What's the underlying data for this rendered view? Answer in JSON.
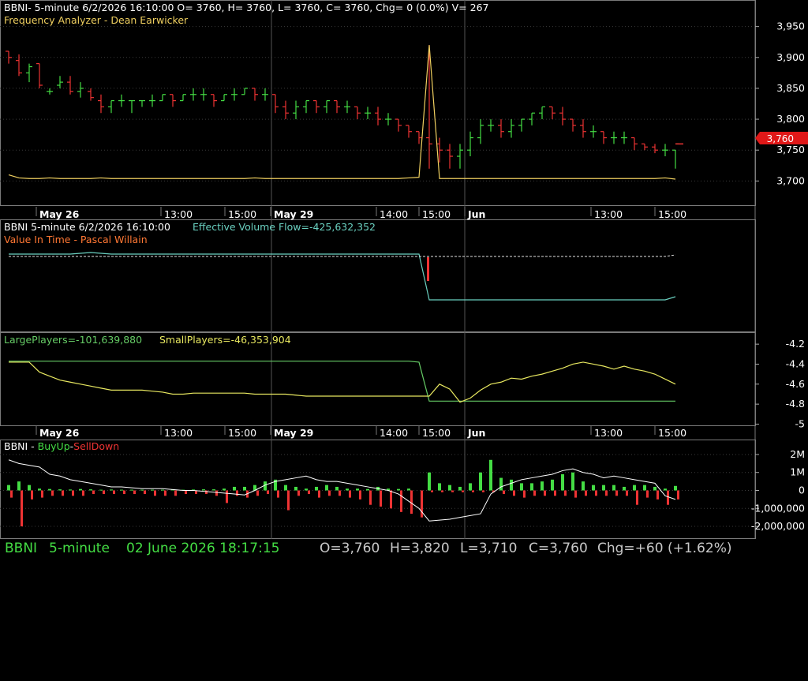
{
  "theme": {
    "bg": "#000000",
    "text": "#ffffff",
    "grid": "#3a3a3a",
    "panel_line": "#7a7a7a",
    "up": "#44dd44",
    "down": "#ee3333",
    "yellow": "#f0d060",
    "cyan": "#6ad0c0",
    "orange": "#ff7733",
    "green_line": "#66cc66",
    "yellow_line": "#e8e860",
    "price_marker": "#e01818"
  },
  "panel1": {
    "header": "BBNI- 5-minute 6/2/2026 16:10:00 O= 3760, H= 3760, L= 3760, C= 3760, Chg= 0 (0.0%) V= 267",
    "indicator": "Frequency Analyzer - Dean Earwicker",
    "price_marker": "3,760"
  },
  "panel2": {
    "header": "BBNI 5-minute  6/2/2026 16:10:00",
    "evf_label": "Effective Volume Flow=-425,632,352",
    "indicator": "Value In Time - Pascal Willain"
  },
  "panel3": {
    "large_label": "LargePlayers=-101,639,880",
    "small_label": "SmallPlayers=-46,353,904"
  },
  "panel4": {
    "title_prefix": "BBNI - ",
    "buyup": "BuyUp",
    "dash": "-",
    "selldown": "SellDown"
  },
  "time_axis": {
    "labels": [
      "May 26",
      "13:00",
      "15:00",
      "May 29",
      "14:00",
      "15:00",
      "Jun",
      "13:00",
      "15:00"
    ],
    "bold": [
      true,
      false,
      false,
      true,
      false,
      false,
      true,
      false,
      false
    ]
  },
  "status_bar": {
    "symbol": "BBNI",
    "interval": "5-minute",
    "datetime": "02 June 2026 18:17:15",
    "open": "O=3,760",
    "high": "H=3,820",
    "low": "L=3,710",
    "close": "C=3,760",
    "chg": "Chg=+60 (+1.62%)"
  },
  "chart_data": [
    {
      "type": "bar",
      "name": "price",
      "y_ticks": [
        "3,950",
        "3,900",
        "3,850",
        "3,800",
        "3,750",
        "3,700"
      ],
      "ylim": [
        3680,
        3970
      ],
      "last_price": 3760,
      "bars": [
        [
          3910,
          3910,
          3890,
          3900
        ],
        [
          3895,
          3905,
          3870,
          3875
        ],
        [
          3875,
          3890,
          3860,
          3885
        ],
        [
          3890,
          3890,
          3850,
          3855
        ],
        [
          3845,
          3850,
          3840,
          3845
        ],
        [
          3855,
          3870,
          3850,
          3860
        ],
        [
          3860,
          3870,
          3840,
          3845
        ],
        [
          3845,
          3860,
          3835,
          3850
        ],
        [
          3845,
          3850,
          3830,
          3835
        ],
        [
          3830,
          3840,
          3810,
          3820
        ],
        [
          3820,
          3830,
          3810,
          3830
        ],
        [
          3830,
          3840,
          3820,
          3830
        ],
        [
          3830,
          3830,
          3810,
          3830
        ],
        [
          3830,
          3830,
          3820,
          3830
        ],
        [
          3830,
          3840,
          3820,
          3830
        ],
        [
          3830,
          3840,
          3830,
          3840
        ],
        [
          3840,
          3840,
          3820,
          3830
        ],
        [
          3830,
          3840,
          3830,
          3840
        ],
        [
          3840,
          3850,
          3830,
          3840
        ],
        [
          3840,
          3850,
          3830,
          3840
        ],
        [
          3840,
          3840,
          3820,
          3830
        ],
        [
          3830,
          3840,
          3830,
          3840
        ],
        [
          3840,
          3850,
          3830,
          3840
        ],
        [
          3840,
          3850,
          3840,
          3850
        ],
        [
          3850,
          3850,
          3830,
          3840
        ],
        [
          3840,
          3850,
          3830,
          3840
        ],
        [
          3840,
          3840,
          3810,
          3820
        ],
        [
          3820,
          3830,
          3800,
          3810
        ],
        [
          3810,
          3830,
          3800,
          3820
        ],
        [
          3820,
          3830,
          3810,
          3830
        ],
        [
          3830,
          3830,
          3810,
          3820
        ],
        [
          3820,
          3830,
          3810,
          3830
        ],
        [
          3830,
          3830,
          3810,
          3820
        ],
        [
          3820,
          3830,
          3810,
          3820
        ],
        [
          3820,
          3820,
          3800,
          3810
        ],
        [
          3810,
          3820,
          3800,
          3810
        ],
        [
          3810,
          3820,
          3790,
          3800
        ],
        [
          3800,
          3810,
          3790,
          3800
        ],
        [
          3800,
          3800,
          3780,
          3790
        ],
        [
          3790,
          3790,
          3770,
          3780
        ],
        [
          3780,
          3780,
          3760,
          3770
        ],
        [
          3770,
          3920,
          3720,
          3760
        ],
        [
          3760,
          3770,
          3730,
          3750
        ],
        [
          3750,
          3760,
          3720,
          3740
        ],
        [
          3740,
          3760,
          3720,
          3750
        ],
        [
          3750,
          3780,
          3740,
          3770
        ],
        [
          3770,
          3800,
          3760,
          3790
        ],
        [
          3790,
          3800,
          3780,
          3790
        ],
        [
          3790,
          3800,
          3770,
          3780
        ],
        [
          3780,
          3800,
          3770,
          3790
        ],
        [
          3790,
          3800,
          3780,
          3800
        ],
        [
          3800,
          3810,
          3790,
          3810
        ],
        [
          3810,
          3820,
          3800,
          3820
        ],
        [
          3820,
          3820,
          3800,
          3810
        ],
        [
          3810,
          3820,
          3790,
          3800
        ],
        [
          3800,
          3800,
          3780,
          3790
        ],
        [
          3790,
          3800,
          3770,
          3780
        ],
        [
          3780,
          3790,
          3770,
          3780
        ],
        [
          3780,
          3780,
          3760,
          3770
        ],
        [
          3770,
          3780,
          3760,
          3770
        ],
        [
          3770,
          3780,
          3760,
          3770
        ],
        [
          3770,
          3770,
          3750,
          3760
        ],
        [
          3760,
          3760,
          3750,
          3755
        ],
        [
          3755,
          3760,
          3745,
          3750
        ],
        [
          3750,
          3760,
          3740,
          3750
        ],
        [
          3750,
          3750,
          3720,
          3760
        ]
      ],
      "freq_line": [
        3710,
        3705,
        3704,
        3704,
        3705,
        3704,
        3704,
        3704,
        3704,
        3705,
        3704,
        3704,
        3704,
        3704,
        3704,
        3704,
        3704,
        3704,
        3704,
        3704,
        3704,
        3704,
        3704,
        3704,
        3705,
        3704,
        3704,
        3704,
        3704,
        3704,
        3704,
        3704,
        3704,
        3704,
        3704,
        3704,
        3704,
        3704,
        3704,
        3705,
        3706,
        3920,
        3704,
        3704,
        3704,
        3704,
        3704,
        3704,
        3704,
        3704,
        3704,
        3704,
        3704,
        3704,
        3704,
        3704,
        3704,
        3704,
        3704,
        3704,
        3704,
        3704,
        3704,
        3704,
        3705,
        3703
      ]
    },
    {
      "type": "line",
      "name": "effective volume flow",
      "series": [
        {
          "values_top": [
            322,
            322,
            322,
            322,
            322,
            322,
            322,
            321,
            320,
            321,
            322,
            322,
            322,
            322,
            322,
            322,
            322,
            322,
            322,
            322,
            322,
            322,
            322,
            322,
            322,
            322,
            322,
            322,
            322,
            322,
            322,
            322,
            322,
            322,
            322,
            322,
            322,
            322,
            322,
            322,
            322,
            380,
            380,
            380,
            380,
            380,
            380,
            380,
            380,
            380,
            380,
            380,
            380,
            380,
            380,
            380,
            380,
            380,
            380,
            380,
            380,
            380,
            380,
            380,
            380,
            376
          ]
        },
        {
          "values_white": [
            325,
            325,
            325,
            325,
            325,
            325,
            325,
            325,
            325,
            325,
            325,
            325,
            325,
            325,
            325,
            325,
            325,
            325,
            325,
            325,
            325,
            325,
            325,
            325,
            325,
            325,
            325,
            325,
            325,
            325,
            325,
            325,
            325,
            325,
            325,
            325,
            325,
            325,
            325,
            325,
            325,
            325,
            325,
            325,
            325,
            325,
            325,
            325,
            325,
            325,
            325,
            325,
            325,
            325,
            325,
            325,
            325,
            325,
            325,
            325,
            325,
            325,
            325,
            325,
            325,
            323
          ]
        }
      ]
    },
    {
      "type": "line",
      "name": "players",
      "y_ticks": [
        "-4.2",
        "-4.4",
        "-4.6",
        "-4.8",
        "-5"
      ],
      "ylim": [
        -5.02,
        -4.12
      ],
      "series": [
        {
          "name": "LargePlayers",
          "values": [
            -4.37,
            -4.37,
            -4.37,
            -4.37,
            -4.37,
            -4.37,
            -4.37,
            -4.37,
            -4.37,
            -4.37,
            -4.37,
            -4.37,
            -4.37,
            -4.37,
            -4.37,
            -4.37,
            -4.37,
            -4.37,
            -4.37,
            -4.37,
            -4.37,
            -4.37,
            -4.37,
            -4.37,
            -4.37,
            -4.37,
            -4.37,
            -4.37,
            -4.37,
            -4.37,
            -4.37,
            -4.37,
            -4.37,
            -4.37,
            -4.37,
            -4.37,
            -4.37,
            -4.37,
            -4.37,
            -4.37,
            -4.38,
            -4.77,
            -4.77,
            -4.77,
            -4.77,
            -4.77,
            -4.77,
            -4.77,
            -4.77,
            -4.77,
            -4.77,
            -4.77,
            -4.77,
            -4.77,
            -4.77,
            -4.77,
            -4.77,
            -4.77,
            -4.77,
            -4.77,
            -4.77,
            -4.77,
            -4.77,
            -4.77,
            -4.77,
            -4.77
          ]
        },
        {
          "name": "SmallPlayers",
          "values": [
            -4.38,
            -4.38,
            -4.38,
            -4.48,
            -4.52,
            -4.56,
            -4.58,
            -4.6,
            -4.62,
            -4.64,
            -4.66,
            -4.66,
            -4.66,
            -4.66,
            -4.67,
            -4.68,
            -4.7,
            -4.7,
            -4.69,
            -4.69,
            -4.69,
            -4.69,
            -4.69,
            -4.69,
            -4.7,
            -4.7,
            -4.7,
            -4.7,
            -4.71,
            -4.72,
            -4.72,
            -4.72,
            -4.72,
            -4.72,
            -4.72,
            -4.72,
            -4.72,
            -4.72,
            -4.72,
            -4.72,
            -4.72,
            -4.72,
            -4.6,
            -4.65,
            -4.78,
            -4.74,
            -4.66,
            -4.6,
            -4.58,
            -4.54,
            -4.55,
            -4.52,
            -4.5,
            -4.47,
            -4.44,
            -4.4,
            -4.38,
            -4.4,
            -4.42,
            -4.45,
            -4.42,
            -4.45,
            -4.47,
            -4.5,
            -4.55,
            -4.6
          ]
        }
      ]
    },
    {
      "type": "bar",
      "name": "BuyUp-SellDown",
      "y_ticks": [
        "2M",
        "1M",
        "0",
        "-1,000,000",
        "-2,000,000"
      ],
      "ylim": [
        -2700000,
        2700000
      ],
      "buy": [
        300000,
        500000,
        300000,
        100000,
        80000,
        60000,
        50000,
        80000,
        60000,
        40000,
        50000,
        40000,
        40000,
        40000,
        40000,
        40000,
        50000,
        40000,
        50000,
        60000,
        60000,
        100000,
        200000,
        200000,
        300000,
        500000,
        600000,
        300000,
        200000,
        100000,
        200000,
        300000,
        200000,
        100000,
        100000,
        80000,
        200000,
        100000,
        80000,
        100000,
        0,
        1000000,
        400000,
        300000,
        200000,
        400000,
        1000000,
        1700000,
        700000,
        600000,
        400000,
        400000,
        500000,
        600000,
        900000,
        1000000,
        500000,
        300000,
        300000,
        300000,
        200000,
        300000,
        300000,
        200000,
        100000,
        250000
      ],
      "sell": [
        -400000,
        -2000000,
        -500000,
        -400000,
        -300000,
        -300000,
        -300000,
        -300000,
        -200000,
        -200000,
        -200000,
        -200000,
        -200000,
        -200000,
        -300000,
        -300000,
        -300000,
        -200000,
        -200000,
        -200000,
        -300000,
        -700000,
        -300000,
        -400000,
        -300000,
        -200000,
        -400000,
        -1100000,
        -300000,
        -200000,
        -400000,
        -300000,
        -300000,
        -400000,
        -500000,
        -800000,
        -900000,
        -1000000,
        -1200000,
        -1300000,
        -1500000,
        -100000,
        -100000,
        -100000,
        -100000,
        -100000,
        -100000,
        -100000,
        -200000,
        -300000,
        -400000,
        -300000,
        -300000,
        -300000,
        -300000,
        -400000,
        -300000,
        -300000,
        -300000,
        -300000,
        -300000,
        -800000,
        -400000,
        -500000,
        -800000,
        -500000
      ],
      "line": [
        1700000,
        1500000,
        1400000,
        1300000,
        900000,
        800000,
        600000,
        500000,
        400000,
        300000,
        200000,
        200000,
        150000,
        100000,
        100000,
        100000,
        50000,
        0,
        0,
        -50000,
        -100000,
        -150000,
        -200000,
        -250000,
        0,
        300000,
        500000,
        600000,
        700000,
        800000,
        600000,
        500000,
        500000,
        400000,
        300000,
        200000,
        100000,
        0,
        -200000,
        -600000,
        -1000000,
        -1700000,
        -1650000,
        -1600000,
        -1500000,
        -1400000,
        -1300000,
        -200000,
        200000,
        400000,
        600000,
        700000,
        800000,
        900000,
        1100000,
        1200000,
        1000000,
        900000,
        700000,
        800000,
        700000,
        600000,
        500000,
        400000,
        -300000,
        -500000
      ]
    }
  ]
}
